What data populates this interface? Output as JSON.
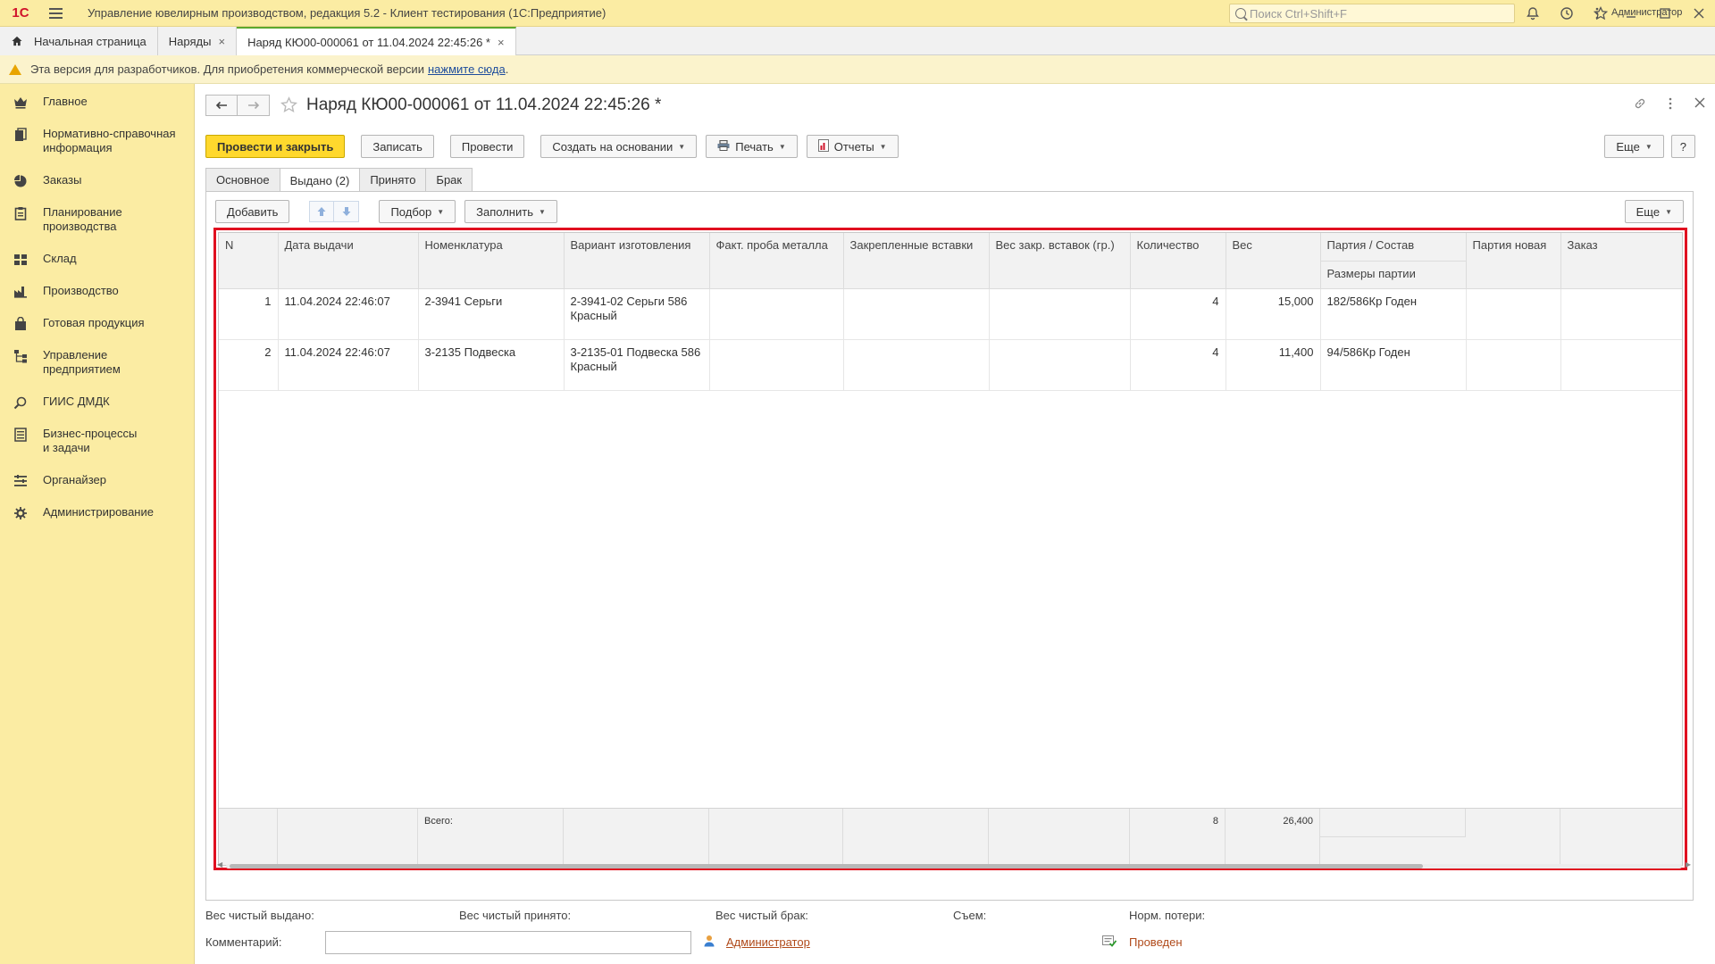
{
  "app": {
    "title": "Управление ювелирным производством, редакция 5.2  - Клиент тестирования (1С:Предприятие)",
    "logo_text": "1С",
    "search_placeholder": "Поиск Ctrl+Shift+F",
    "user": "Администратор"
  },
  "window_tabs": [
    {
      "label": "Начальная страница"
    },
    {
      "label": "Наряды"
    },
    {
      "label": "Наряд КЮ00-000061 от 11.04.2024 22:45:26 *"
    }
  ],
  "notice": {
    "text": "Эта версия для разработчиков. Для приобретения коммерческой версии",
    "link": "нажмите сюда",
    "tail": "."
  },
  "sidebar": {
    "items": [
      {
        "label": "Главное",
        "icon": "crown-icon"
      },
      {
        "label": "Нормативно-справочная информация",
        "icon": "books-icon"
      },
      {
        "label": "Заказы",
        "icon": "pie-icon"
      },
      {
        "label": "Планирование производства",
        "icon": "clipboard-icon"
      },
      {
        "label": "Склад",
        "icon": "warehouse-icon"
      },
      {
        "label": "Производство",
        "icon": "factory-icon"
      },
      {
        "label": "Готовая продукция",
        "icon": "bag-icon"
      },
      {
        "label": "Управление предприятием",
        "icon": "org-chart-icon"
      },
      {
        "label": "ГИИС ДМДК",
        "icon": "link-icon"
      },
      {
        "label": "Бизнес-процессы и задачи",
        "icon": "tasks-icon"
      },
      {
        "label": "Органайзер",
        "icon": "organizer-icon"
      },
      {
        "label": "Администрирование",
        "icon": "gear-icon"
      }
    ]
  },
  "document": {
    "title": "Наряд КЮ00-000061 от 11.04.2024 22:45:26 *",
    "toolbar": {
      "post_close": "Провести и закрыть",
      "save": "Записать",
      "post": "Провести",
      "create_based": "Создать на основании",
      "print": "Печать",
      "reports": "Отчеты",
      "more": "Еще",
      "help": "?"
    },
    "tabs": [
      "Основное",
      "Выдано (2)",
      "Принято",
      "Брак"
    ],
    "table_toolbar": {
      "add": "Добавить",
      "pick": "Подбор",
      "fill": "Заполнить",
      "more": "Еще"
    },
    "table": {
      "columns": [
        "N",
        "Дата выдачи",
        "Номенклатура",
        "Вариант изготовления",
        "Факт. проба металла",
        "Закрепленные вставки",
        "Вес закр. вставок (гр.)",
        "Количество",
        "Вес",
        "Партия / Состав",
        "Партия новая",
        "Заказ"
      ],
      "subheader": "Размеры партии",
      "rows": [
        {
          "n": "1",
          "date": "11.04.2024 22:46:07",
          "item": "2-3941 Серьги",
          "variant": "2-3941-02 Серьги 586 Красный",
          "probe": "",
          "inserts": "",
          "insert_weight": "",
          "qty": "4",
          "weight": "15,000",
          "batch": "182/586Кр Годен",
          "new_batch": "",
          "order": ""
        },
        {
          "n": "2",
          "date": "11.04.2024 22:46:07",
          "item": "3-2135 Подвеска",
          "variant": "3-2135-01 Подвеска 586 Красный",
          "probe": "",
          "inserts": "",
          "insert_weight": "",
          "qty": "4",
          "weight": "11,400",
          "batch": "94/586Кр Годен",
          "new_batch": "",
          "order": ""
        }
      ],
      "footer": {
        "label": "Всего:",
        "qty": "8",
        "weight": "26,400"
      }
    },
    "form": {
      "net_issued": "Вес чистый выдано:",
      "net_received": "Вес чистый принято:",
      "net_defect": "Вес чистый брак:",
      "removal": "Съем:",
      "norm_loss": "Норм. потери:",
      "comment_label": "Комментарий:",
      "comment_value": "",
      "author": "Администратор",
      "status": "Проведен"
    }
  }
}
